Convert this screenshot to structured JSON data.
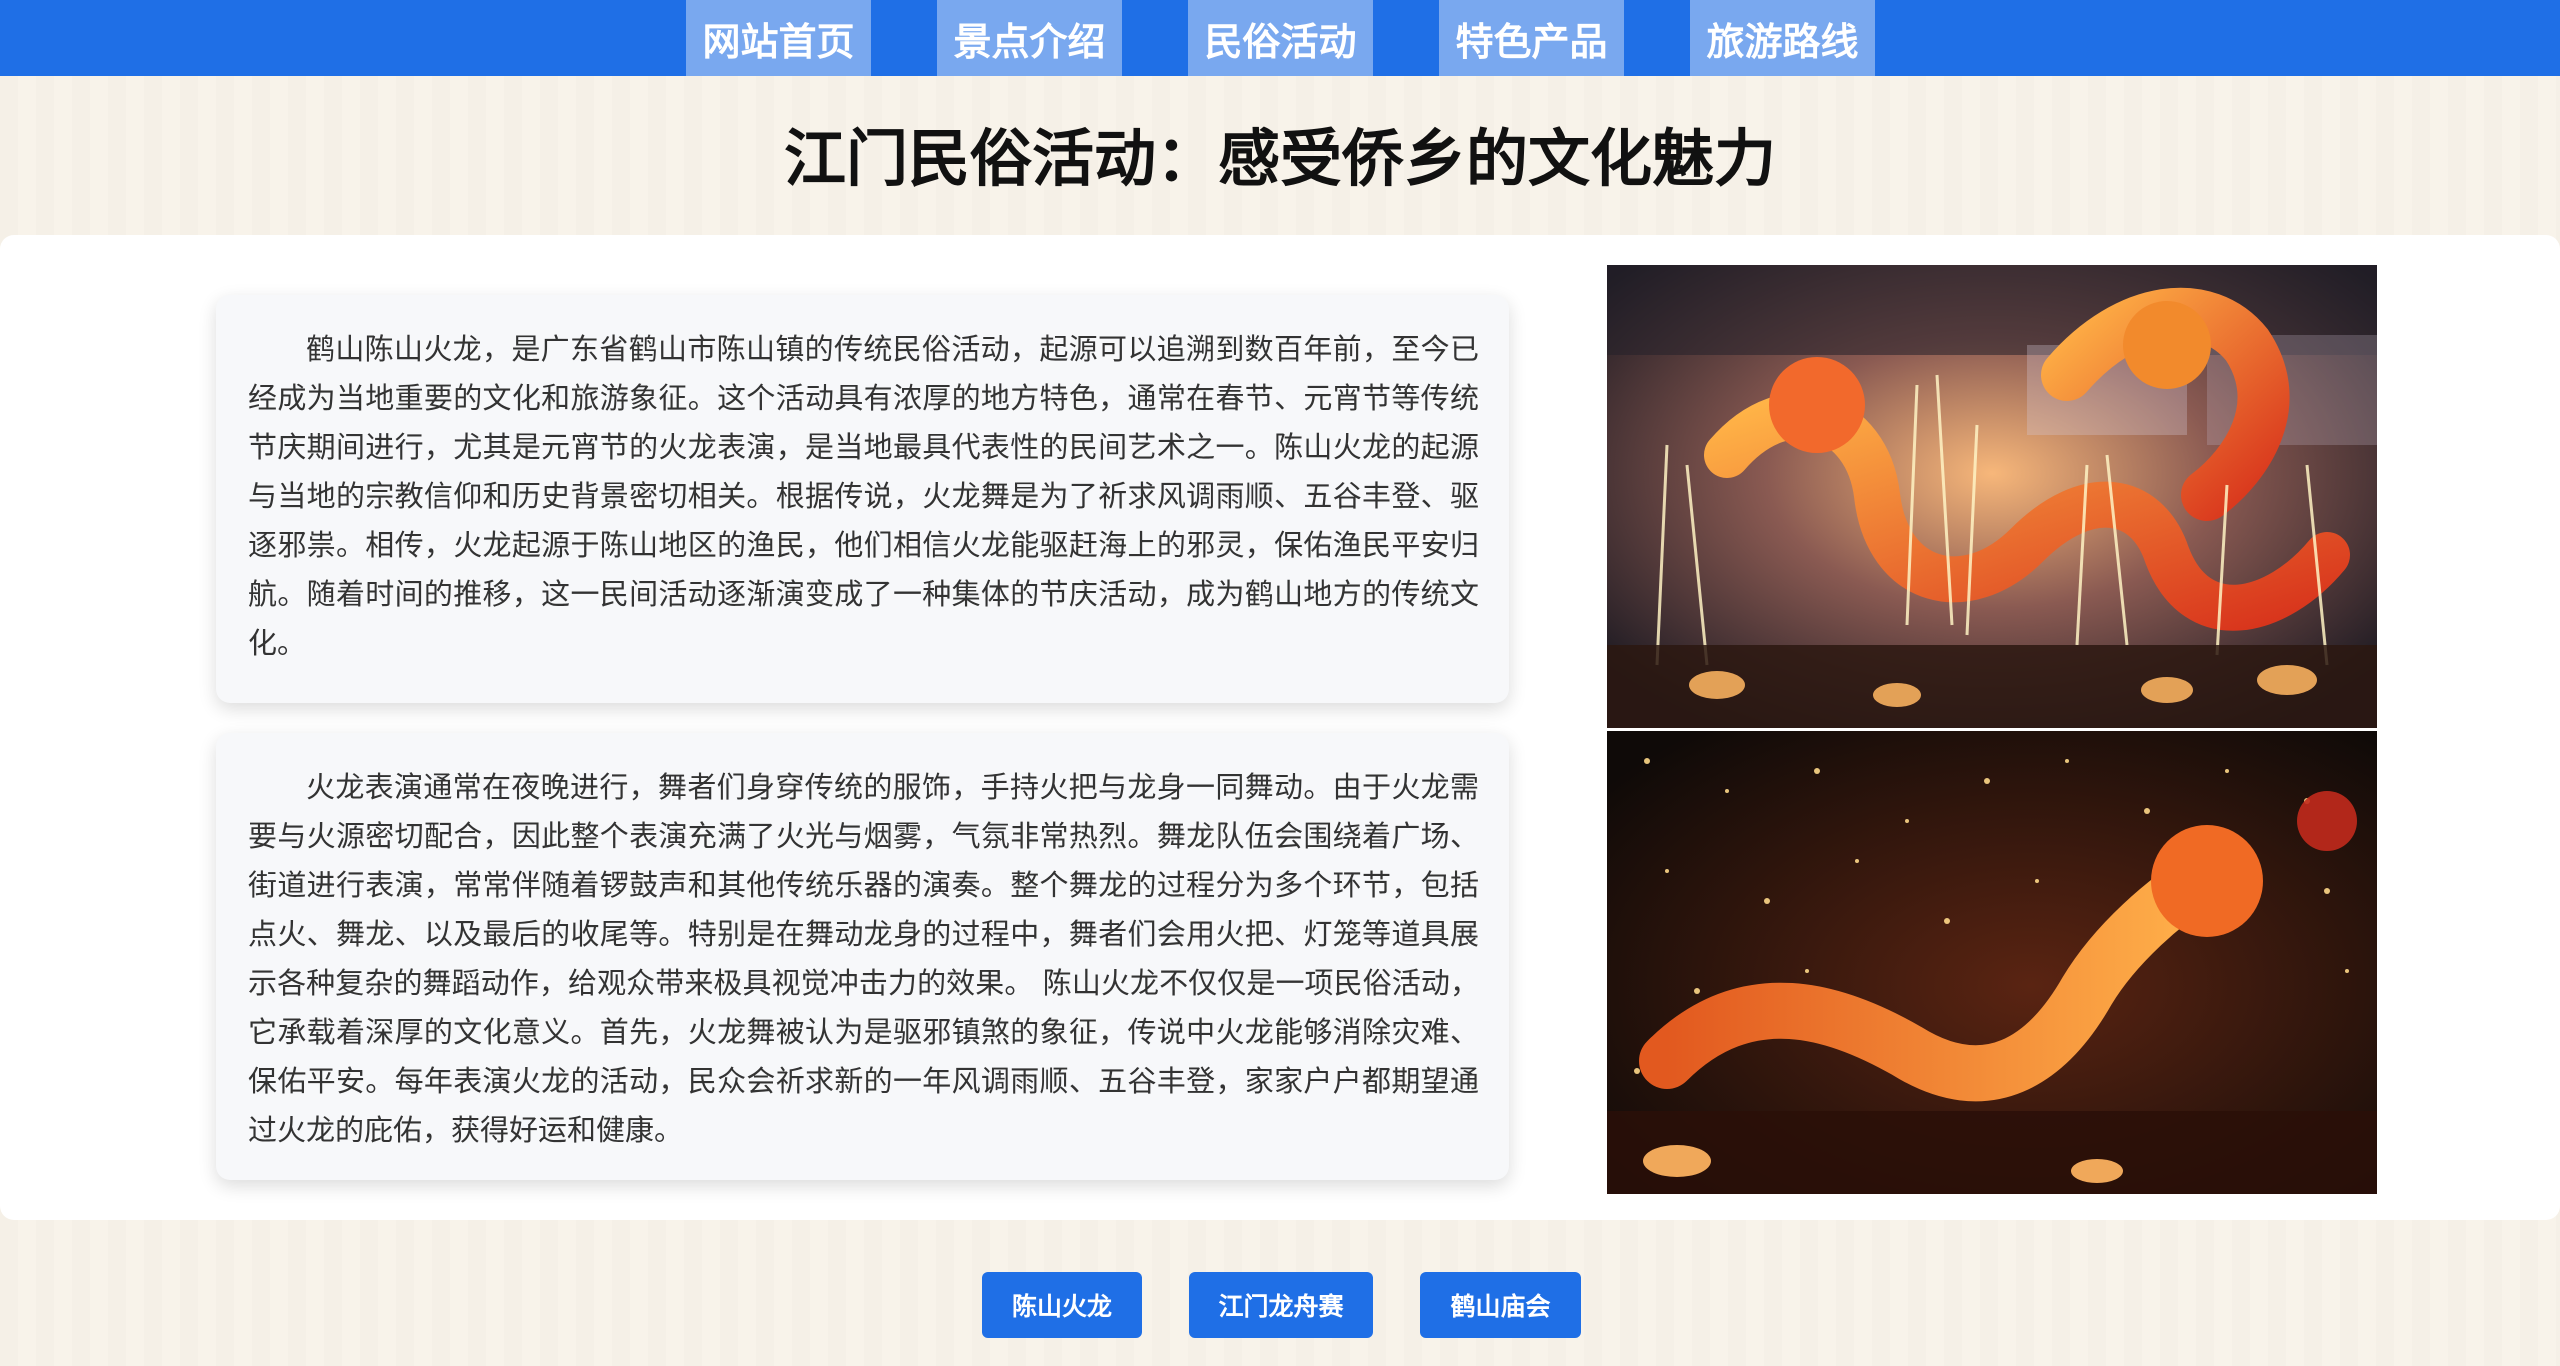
{
  "nav": {
    "items": [
      {
        "label": "网站首页"
      },
      {
        "label": "景点介绍"
      },
      {
        "label": "民俗活动"
      },
      {
        "label": "特色产品"
      },
      {
        "label": "旅游路线"
      }
    ]
  },
  "page": {
    "title": "江门民俗活动：感受侨乡的文化魅力"
  },
  "article": {
    "card1_text": "鹤山陈山火龙，是广东省鹤山市陈山镇的传统民俗活动，起源可以追溯到数百年前，至今已经成为当地重要的文化和旅游象征。这个活动具有浓厚的地方特色，通常在春节、元宵节等传统节庆期间进行，尤其是元宵节的火龙表演，是当地最具代表性的民间艺术之一。陈山火龙的起源与当地的宗教信仰和历史背景密切相关。根据传说，火龙舞是为了祈求风调雨顺、五谷丰登、驱逐邪祟。相传，火龙起源于陈山地区的渔民，他们相信火龙能驱赶海上的邪灵，保佑渔民平安归航。随着时间的推移，这一民间活动逐渐演变成了一种集体的节庆活动，成为鹤山地方的传统文化。",
    "card2_text": "火龙表演通常在夜晚进行，舞者们身穿传统的服饰，手持火把与龙身一同舞动。由于火龙需要与火源密切配合，因此整个表演充满了火光与烟雾，气氛非常热烈。舞龙队伍会围绕着广场、街道进行表演，常常伴随着锣鼓声和其他传统乐器的演奏。整个舞龙的过程分为多个环节，包括点火、舞龙、以及最后的收尾等。特别是在舞动龙身的过程中，舞者们会用火把、灯笼等道具展示各种复杂的舞蹈动作，给观众带来极具视觉冲击力的效果。 陈山火龙不仅仅是一项民俗活动，它承载着深厚的文化意义。首先，火龙舞被认为是驱邪镇煞的象征，传说中火龙能够消除灾难、保佑平安。每年表演火龙的活动，民众会祈求新的一年风调雨顺、五谷丰登，家家户户都期望通过火龙的庇佑，获得好运和健康。"
  },
  "links": {
    "items": [
      {
        "label": "陈山火龙"
      },
      {
        "label": "江门龙舟赛"
      },
      {
        "label": "鹤山庙会"
      }
    ]
  },
  "colors": {
    "nav_bar": "#1f6fe6",
    "nav_item": "#79a8ef",
    "page_bg": "#f8f3ea",
    "card_bg": "#f7f8fa"
  }
}
